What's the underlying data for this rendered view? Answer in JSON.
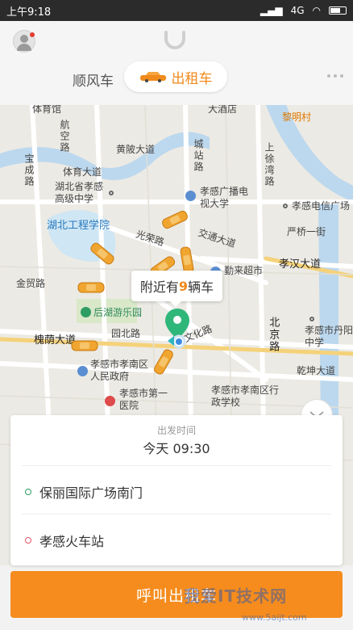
{
  "status_bar": {
    "time": "上午9:18",
    "network": "4G"
  },
  "header": {
    "tabs": [
      {
        "label": "顺风车",
        "active": false
      },
      {
        "label": "出租车",
        "active": true
      }
    ],
    "accent_color": "#f08a1b"
  },
  "map": {
    "labels": {
      "hangkong_road": "航空路",
      "huangpi_road": "黄陂大道",
      "chengzhan_road": "城站路",
      "shangxu_road": "上徐湾路",
      "baocheng_road": "宝成路",
      "tiyu_road": "体育大道",
      "school": "湖北省孝感高级中学",
      "guangbo": "孝感广播电视大学",
      "telecom": "孝感电信广场",
      "college": "湖北工程学院",
      "guangrong_road": "光荣路",
      "jiaotong_road": "交通大道",
      "yanqiao": "严桥一街",
      "xiaohan_road": "孝汉大道",
      "qinlai": "勤来超市",
      "jinmao_road": "金贸路",
      "houhu": "后湖游乐园",
      "wenhua_road": "文化路",
      "beijing_road": "北京路",
      "danyang": "孝感市丹阳中学",
      "huaiyin_road": "槐荫大道",
      "yuanbei_road": "园北路",
      "gov": "孝感市孝南区人民政府",
      "qiantai_road": "乾坤大道",
      "hospital": "孝感市第一医院",
      "admin_school": "孝感市孝南区行政学校",
      "liming": "黎明村",
      "hotel": "大酒店",
      "tiyuguan": "体育馆"
    },
    "tooltip": {
      "prefix": "附近有",
      "count": "9",
      "suffix": "辆车"
    }
  },
  "panel": {
    "depart_label": "出发时间",
    "depart_value": "今天 09:30",
    "start_location": "保丽国际广场南门",
    "end_location": "孝感火车站"
  },
  "call_button": {
    "label": "呼叫出租车"
  },
  "watermark": {
    "text": "我爱IT技术网",
    "sub": "www.5aijt.com"
  }
}
